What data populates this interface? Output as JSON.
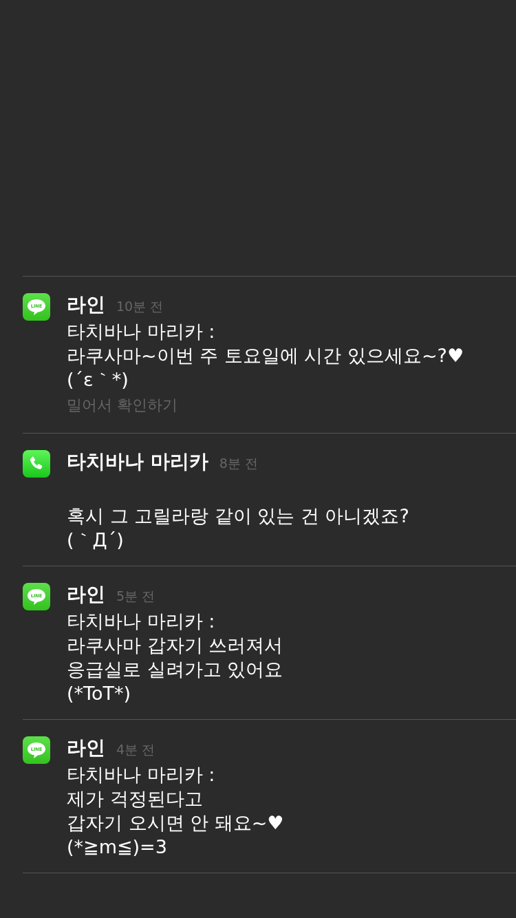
{
  "notifications": [
    {
      "kind": "line",
      "icon_text": "LINE",
      "title": "라인",
      "time": "10분 전",
      "lines": [
        "타치바나 마리카 :",
        "라쿠사마~이번 주 토요일에 시간 있으세요~?♥",
        "(´ε｀*)"
      ],
      "hint": "밀어서 확인하기"
    },
    {
      "kind": "phone",
      "title": "타치바나 마리카",
      "time": "8분 전",
      "lines": [
        "혹시 그 고릴라랑 같이 있는 건 아니겠죠?",
        "(｀Д´)"
      ]
    },
    {
      "kind": "line",
      "icon_text": "LINE",
      "title": "라인",
      "time": "5분 전",
      "lines": [
        "타치바나 마리카 :",
        "라쿠사마 갑자기 쓰러져서",
        "응급실로 실려가고 있어요",
        "(*ToT*)"
      ]
    },
    {
      "kind": "line",
      "icon_text": "LINE",
      "title": "라인",
      "time": "4분 전",
      "lines": [
        "타치바나 마리카 :",
        "제가 걱정된다고",
        "갑자기 오시면 안 돼요~♥",
        "(*≧m≦)=3"
      ]
    }
  ]
}
